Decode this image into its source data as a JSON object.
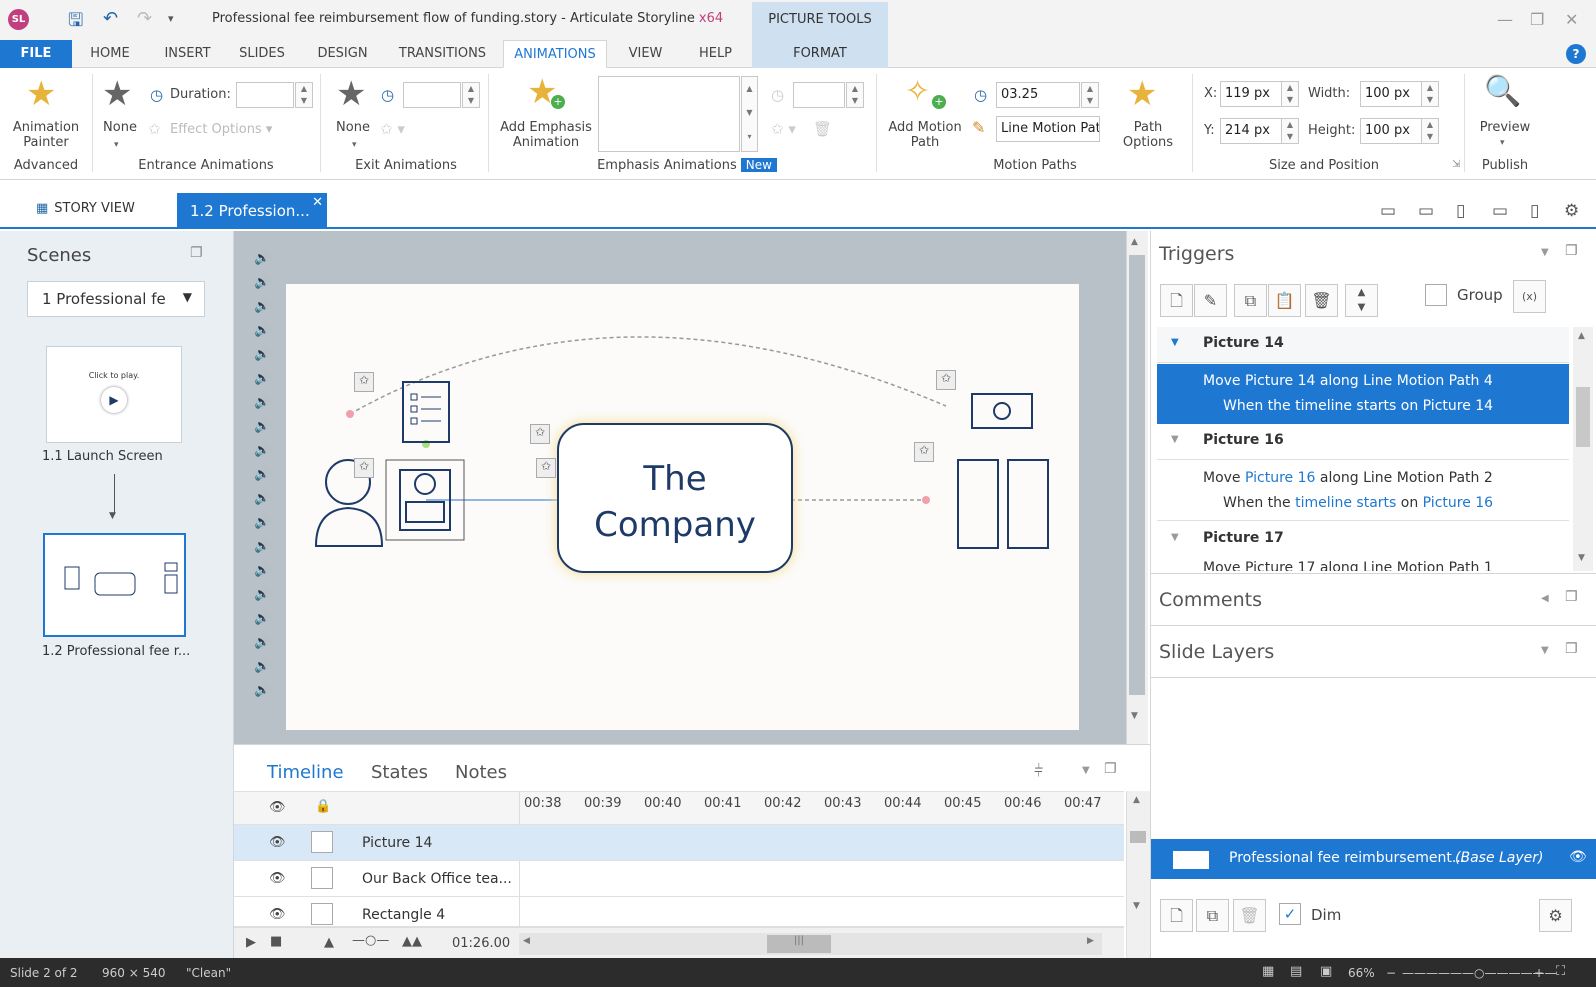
{
  "app": {
    "logo": "SL",
    "title": "Professional fee reimbursement flow of funding.story - Articulate Storyline",
    "arch": "x64",
    "context_tab": "PICTURE TOOLS"
  },
  "tabs": [
    "FILE",
    "HOME",
    "INSERT",
    "SLIDES",
    "DESIGN",
    "TRANSITIONS",
    "ANIMATIONS",
    "VIEW",
    "HELP",
    "FORMAT"
  ],
  "ribbon": {
    "animation_painter": "Animation\nPainter",
    "advanced": "Advanced",
    "entrance_none": "None",
    "duration_label": "Duration:",
    "effect_options": "Effect Options",
    "entrance_group": "Entrance Animations",
    "exit_none": "None",
    "exit_group": "Exit Animations",
    "add_emphasis": "Add Emphasis\nAnimation",
    "emphasis_group": "Emphasis Animations",
    "new_badge": "New",
    "add_motion_path": "Add Motion\nPath",
    "motion_duration": "03.25",
    "motion_path_name": "Line Motion Pat",
    "path_options": "Path\nOptions",
    "motion_group": "Motion Paths",
    "x_label": "X:",
    "x_value": "119 px",
    "y_label": "Y:",
    "y_value": "214 px",
    "width_label": "Width:",
    "width_value": "100 px",
    "height_label": "Height:",
    "height_value": "100 px",
    "size_group": "Size and Position",
    "preview": "Preview",
    "publish": "Publish"
  },
  "viewbar": {
    "story_view": "STORY VIEW",
    "slide_tab": "1.2 Profession..."
  },
  "scenes": {
    "title": "Scenes",
    "selector": "1 Professional fe",
    "thumb1_text": "Click to play.",
    "slide1_label": "1.1 Launch Screen",
    "slide2_label": "1.2 Professional fee r..."
  },
  "slide": {
    "company_line1": "The",
    "company_line2": "Company"
  },
  "triggers": {
    "title": "Triggers",
    "group_label": "Group",
    "items": [
      {
        "header": "Picture 14",
        "line1": "Move Picture 14 along Line Motion Path 4",
        "line2": "When the timeline starts on Picture 14"
      },
      {
        "header": "Picture 16",
        "line1_a": "Move ",
        "line1_pict": "Picture 16",
        "line1_b": " along Line Motion Path 2",
        "line2_a": "When the ",
        "line2_tl": "timeline starts",
        "line2_b": " on ",
        "line2_pict": "Picture 16"
      },
      {
        "header": "Picture 17",
        "line1": "Move Picture 17 along Line Motion Path 1"
      }
    ]
  },
  "comments_title": "Comments",
  "layers_title": "Slide Layers",
  "base_layer": {
    "name": "Professional fee reimbursement...",
    "tag": "(Base Layer)",
    "dim_label": "Dim"
  },
  "timeline": {
    "tabs": [
      "Timeline",
      "States",
      "Notes"
    ],
    "ticks": [
      "00:38",
      "00:39",
      "00:40",
      "00:41",
      "00:42",
      "00:43",
      "00:44",
      "00:45",
      "00:46",
      "00:47"
    ],
    "rows": [
      "Picture 14",
      "Our Back Office tea...",
      "Rectangle 4"
    ],
    "total_time": "01:26.00"
  },
  "status": {
    "slide": "Slide 2 of 2",
    "size": "960 × 540",
    "theme": "\"Clean\"",
    "zoom": "66%"
  }
}
